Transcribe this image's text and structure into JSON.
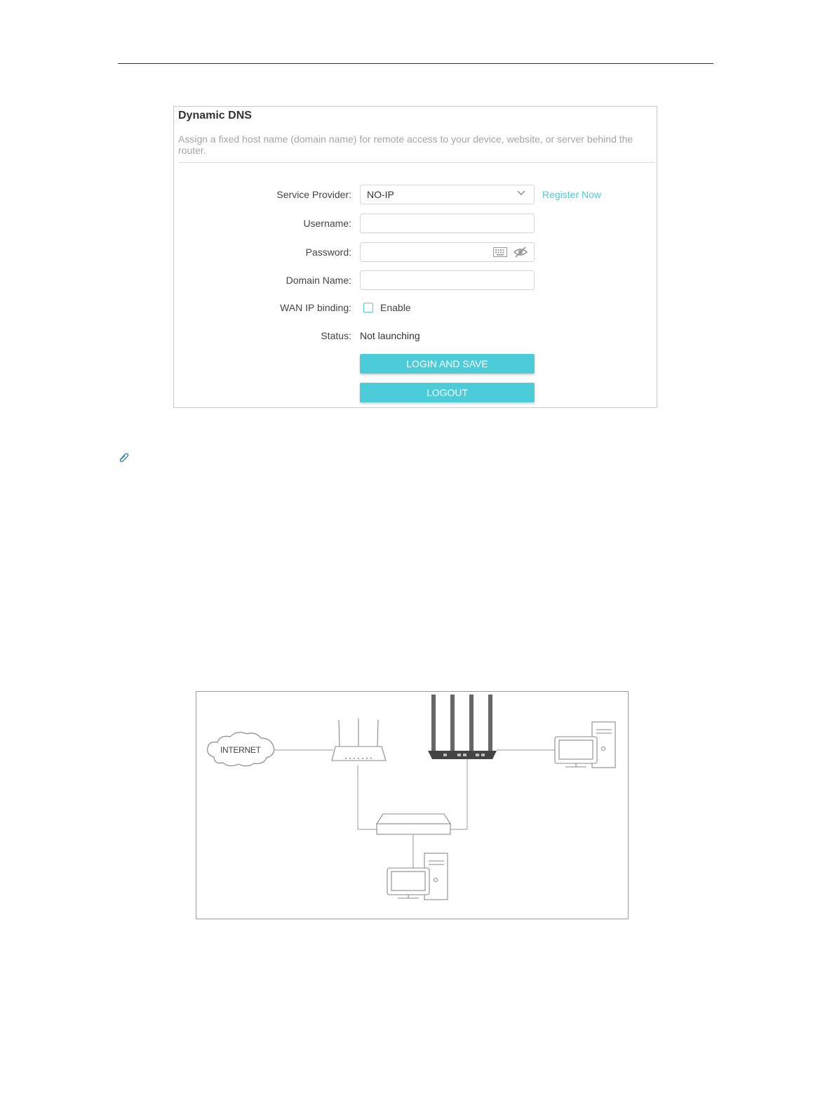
{
  "panel": {
    "title": "Dynamic DNS",
    "description": "Assign a fixed host name (domain name) for remote access to your device, website, or server behind the router."
  },
  "form": {
    "service_provider": {
      "label": "Service Provider:",
      "value": "NO-IP",
      "link": "Register Now"
    },
    "username": {
      "label": "Username:",
      "value": ""
    },
    "password": {
      "label": "Password:",
      "value": ""
    },
    "domain_name": {
      "label": "Domain Name:",
      "value": ""
    },
    "wan_ip_binding": {
      "label": "WAN IP binding:",
      "checkbox_label": "Enable",
      "checked": false
    },
    "status": {
      "label": "Status:",
      "value": "Not launching"
    },
    "login_button": "LOGIN AND SAVE",
    "logout_button": "LOGOUT"
  },
  "accent_color": "#4ccbd8",
  "icons": [
    "chevron-down-icon",
    "keyboard-icon",
    "eye-slash-icon",
    "paperclip-icon"
  ],
  "diagram": {
    "cloud_label": "INTERNET"
  }
}
